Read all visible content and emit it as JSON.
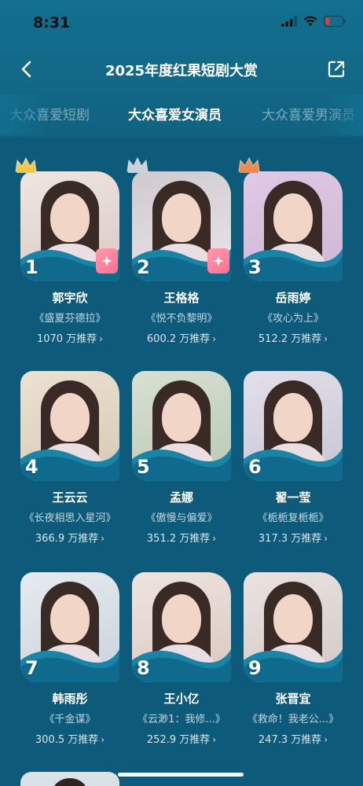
{
  "status": {
    "time": "8:31"
  },
  "header": {
    "title": "2025年度红果短剧大赏"
  },
  "tabs": [
    {
      "label": "大众喜爱短剧"
    },
    {
      "label": "大众喜爱女演员"
    },
    {
      "label": "大众喜爱男演员"
    }
  ],
  "colors": {
    "accent": "#13708f",
    "gold": "#f2c84b",
    "silver": "#c9d2d8",
    "bronze": "#f08a4b"
  },
  "actresses": [
    {
      "rank": "1",
      "name": "郭宇欣",
      "drama": "《盛夏芬德拉》",
      "recommend": "1070 万推荐",
      "crown": "gold-crown-icon",
      "badge": true
    },
    {
      "rank": "2",
      "name": "王格格",
      "drama": "《悦不负黎明》",
      "recommend": "600.2 万推荐",
      "crown": "silver-crown-icon",
      "badge": true
    },
    {
      "rank": "3",
      "name": "岳雨婷",
      "drama": "《攻心为上》",
      "recommend": "512.2 万推荐",
      "crown": "bronze-crown-icon",
      "badge": false
    },
    {
      "rank": "4",
      "name": "王云云",
      "drama": "《长夜相思入星河》",
      "recommend": "366.9 万推荐",
      "crown": "",
      "badge": false
    },
    {
      "rank": "5",
      "name": "孟娜",
      "drama": "《傲慢与偏爱》",
      "recommend": "351.2 万推荐",
      "crown": "",
      "badge": false
    },
    {
      "rank": "6",
      "name": "翟一莹",
      "drama": "《栀栀复栀栀》",
      "recommend": "317.3 万推荐",
      "crown": "",
      "badge": false
    },
    {
      "rank": "7",
      "name": "韩雨彤",
      "drama": "《千金谋》",
      "recommend": "300.5 万推荐",
      "crown": "",
      "badge": false
    },
    {
      "rank": "8",
      "name": "王小亿",
      "drama": "《云渺1：我修...》",
      "recommend": "252.9 万推荐",
      "crown": "",
      "badge": false
    },
    {
      "rank": "9",
      "name": "张晋宜",
      "drama": "《救命！我老公...》",
      "recommend": "247.3 万推荐",
      "crown": "",
      "badge": false
    }
  ]
}
